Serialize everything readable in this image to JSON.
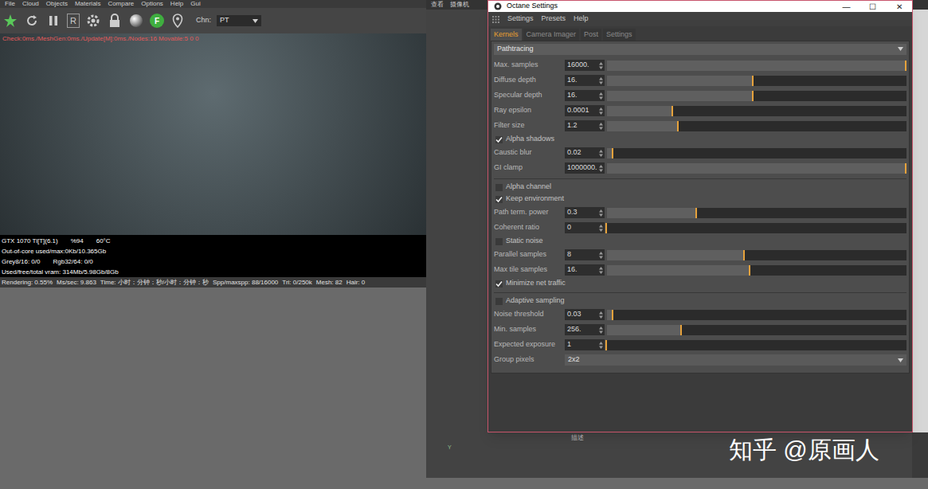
{
  "host": {
    "menu": [
      "File",
      "Cloud",
      "Objects",
      "Materials",
      "Compare",
      "Options",
      "Help",
      "Gui"
    ],
    "toolbar_letters": [
      "R",
      "F"
    ],
    "channel": {
      "label": "Chn:",
      "value": "PT"
    },
    "overlay": "Check:0ms./MeshGen:0ms./Update[M]:0ms./Nodes:16 Movable:5  0 0",
    "status_lines": [
      [
        "GTX 1070 Ti[T](6.1)",
        "%94",
        "60°C"
      ],
      [
        "Out-of-core used/max:0Kb/10.365Gb"
      ],
      [
        "Grey8/16: 0/0",
        "Rgb32/64: 0/0"
      ],
      [
        "Used/free/total vram: 314Mb/5.98Gb/8Gb"
      ]
    ],
    "render_stats": [
      "Rendering: 0.55%",
      "Ms/sec: 9.863",
      "Time: 小时：分钟：秒/小时：分钟：秒",
      "Spp/maxspp: 88/16000",
      "Tri: 0/250k",
      "Mesh: 82",
      "Hair: 0"
    ]
  },
  "viewport": {
    "tabs": [
      "查看",
      "摄像机"
    ],
    "label": "描述",
    "axis": "Y"
  },
  "window": {
    "title": "Octane Settings",
    "controls": [
      "—",
      "☐",
      "✕"
    ],
    "menu": [
      "Settings",
      "Presets",
      "Help"
    ],
    "tabs": [
      {
        "label": "Kernels",
        "selected": true
      },
      {
        "label": "Camera Imager",
        "selected": false
      },
      {
        "label": "Post",
        "selected": false
      },
      {
        "label": "Settings",
        "selected": false
      }
    ],
    "kernel": "Pathtracing",
    "groups": [
      [
        {
          "kind": "slider",
          "label": "Max. samples",
          "value": "16000.",
          "level": 1.0
        },
        {
          "kind": "slider",
          "label": "Diffuse depth",
          "value": "16.",
          "level": 0.49
        },
        {
          "kind": "slider",
          "label": "Specular depth",
          "value": "16.",
          "level": 0.49
        },
        {
          "kind": "slider",
          "label": "Ray epsilon",
          "value": "0.0001",
          "level": 0.22
        },
        {
          "kind": "slider",
          "label": "Filter size",
          "value": "1.2",
          "level": 0.24
        },
        {
          "kind": "check",
          "label": "Alpha shadows",
          "checked": true
        },
        {
          "kind": "slider",
          "label": "Caustic blur",
          "value": "0.02",
          "level": 0.02
        },
        {
          "kind": "slider",
          "label": "GI clamp",
          "value": "1000000.",
          "level": 1.0
        }
      ],
      [
        {
          "kind": "check",
          "label": "Alpha channel",
          "checked": false
        },
        {
          "kind": "check",
          "label": "Keep environment",
          "checked": true
        },
        {
          "kind": "slider",
          "label": "Path term. power",
          "value": "0.3",
          "level": 0.3
        },
        {
          "kind": "slider",
          "label": "Coherent ratio",
          "value": "0",
          "level": 0.0
        },
        {
          "kind": "check",
          "label": "Static noise",
          "checked": false
        },
        {
          "kind": "slider",
          "label": "Parallel samples",
          "value": "8",
          "level": 0.46
        },
        {
          "kind": "slider",
          "label": "Max tile samples",
          "value": "16.",
          "level": 0.48
        },
        {
          "kind": "check",
          "label": "Minimize net traffic",
          "checked": true
        }
      ],
      [
        {
          "kind": "check",
          "label": "Adaptive sampling",
          "checked": false
        },
        {
          "kind": "slider",
          "label": "Noise threshold",
          "value": "0.03",
          "level": 0.02
        },
        {
          "kind": "slider",
          "label": "Min. samples",
          "value": "256.",
          "level": 0.25
        },
        {
          "kind": "slider",
          "label": "Expected exposure",
          "value": "1",
          "level": 0.0
        },
        {
          "kind": "select",
          "label": "Group pixels",
          "value": "2x2"
        }
      ]
    ]
  },
  "watermark": "知乎 @原画人"
}
